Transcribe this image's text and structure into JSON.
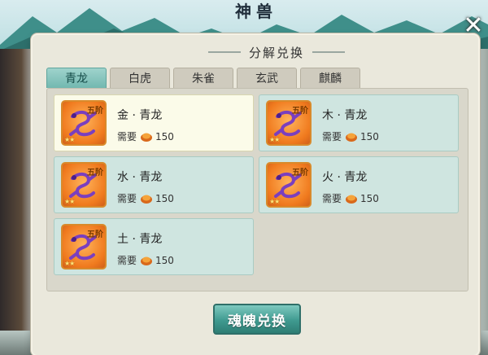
{
  "background": {
    "title": "神兽"
  },
  "dialog": {
    "title": "分解兑换",
    "close_icon": "close-icon",
    "tabs": [
      {
        "label": "青龙",
        "active": true
      },
      {
        "label": "白虎",
        "active": false
      },
      {
        "label": "朱雀",
        "active": false
      },
      {
        "label": "玄武",
        "active": false
      },
      {
        "label": "麒麟",
        "active": false
      }
    ],
    "cards": [
      {
        "name": "金 · 青龙",
        "rank": "五阶",
        "cost_label": "需要",
        "cost": "150",
        "selected": true
      },
      {
        "name": "木 · 青龙",
        "rank": "五阶",
        "cost_label": "需要",
        "cost": "150",
        "selected": false
      },
      {
        "name": "水 · 青龙",
        "rank": "五阶",
        "cost_label": "需要",
        "cost": "150",
        "selected": false
      },
      {
        "name": "火 · 青龙",
        "rank": "五阶",
        "cost_label": "需要",
        "cost": "150",
        "selected": false
      },
      {
        "name": "土 · 青龙",
        "rank": "五阶",
        "cost_label": "需要",
        "cost": "150",
        "selected": false
      }
    ],
    "exchange_button": "魂魄兑换"
  },
  "colors": {
    "accent": "#72b8b0",
    "card_bg": "#cfe5e0",
    "card_selected_bg": "#fbfbe9",
    "icon_orange": "#f07a1e",
    "dragon_purple": "#7a3fbf"
  }
}
